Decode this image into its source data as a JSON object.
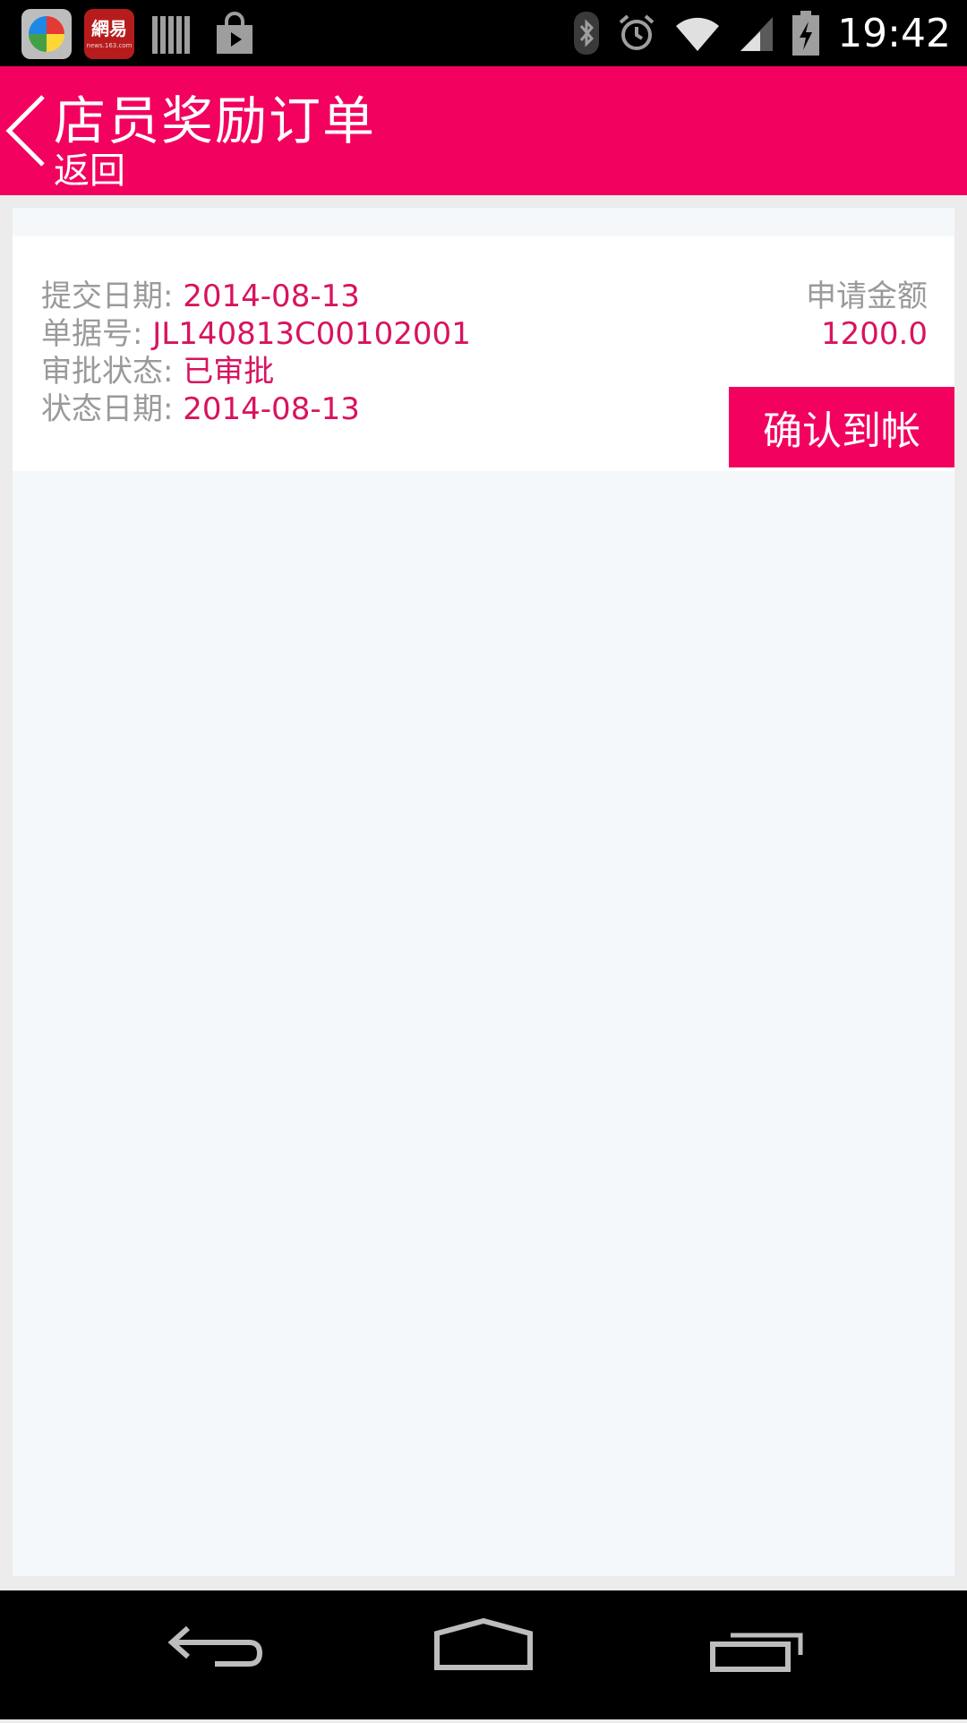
{
  "status_bar": {
    "time": "19:42",
    "notification_icons": [
      "game-center-icon",
      "netease-icon",
      "library-icon",
      "shopping-bag-icon"
    ],
    "netease_text": "網易",
    "netease_subtext": "news.163.com",
    "system_icons": [
      "bluetooth-icon",
      "alarm-icon",
      "wifi-icon",
      "signal-icon",
      "battery-charging-icon"
    ]
  },
  "header": {
    "title": "店员奖励订单",
    "back_label": "返回",
    "background": "#f2015f"
  },
  "order": {
    "submit_date_label": "提交日期: ",
    "submit_date": "2014-08-13",
    "doc_no_label": "单据号: ",
    "doc_no": "JL140813C00102001",
    "approval_status_label": "审批状态: ",
    "approval_status": "已审批",
    "status_date_label": "状态日期: ",
    "status_date": "2014-08-13",
    "amount_label": "申请金额",
    "amount": "1200.0",
    "confirm_button": "确认到帐"
  },
  "nav_bar": {
    "buttons": [
      "back-icon",
      "home-icon",
      "recent-apps-icon"
    ]
  },
  "colors": {
    "accent": "#f2015f",
    "value_text": "#d8135f",
    "label_text": "#9a9a9a"
  }
}
